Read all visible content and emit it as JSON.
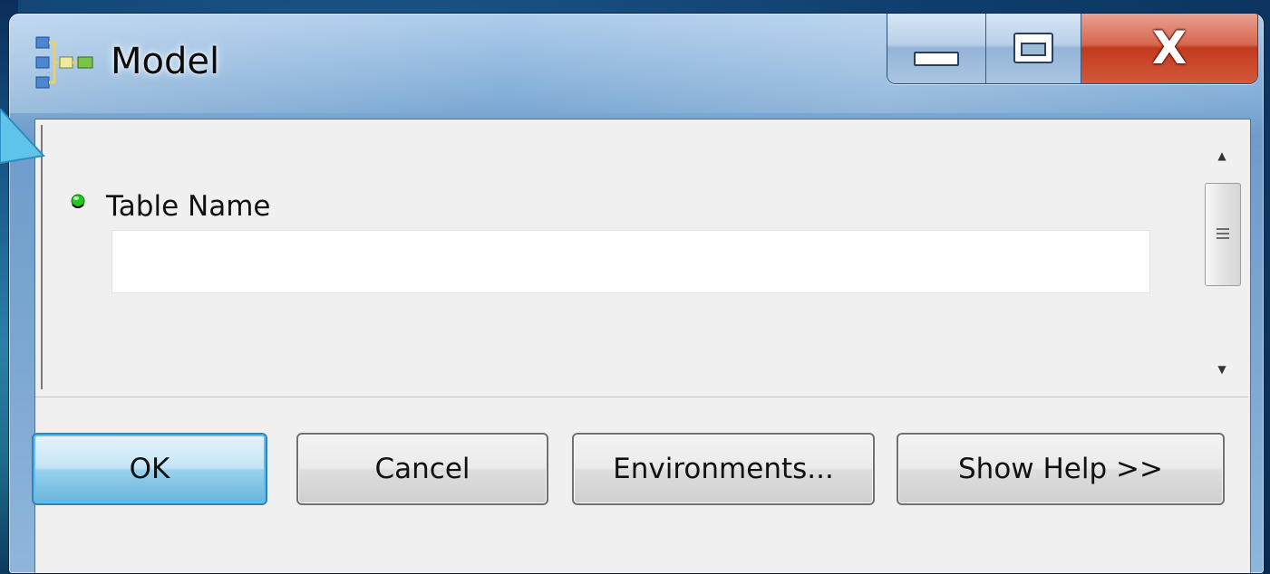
{
  "window": {
    "title": "Model",
    "app_icon": "model-builder-icon",
    "caption": {
      "minimize_icon": "minimize-icon",
      "maximize_icon": "maximize-icon",
      "close_glyph": "X"
    }
  },
  "parameters": [
    {
      "label": "Table Name",
      "value": "",
      "status_icon": "green-dot-icon",
      "status_color": "#22c022"
    }
  ],
  "scrollbar": {
    "up_glyph": "▲",
    "down_glyph": "▼"
  },
  "buttons": {
    "ok_label": "OK",
    "cancel_label": "Cancel",
    "environments_label": "Environments...",
    "show_help_label": "Show Help >>"
  },
  "colors": {
    "titlebar_accent": "#7ca7d2",
    "close_red": "#c23a1d",
    "ok_focus": "#58c3f2",
    "panel_bg": "#f0f0f0"
  }
}
